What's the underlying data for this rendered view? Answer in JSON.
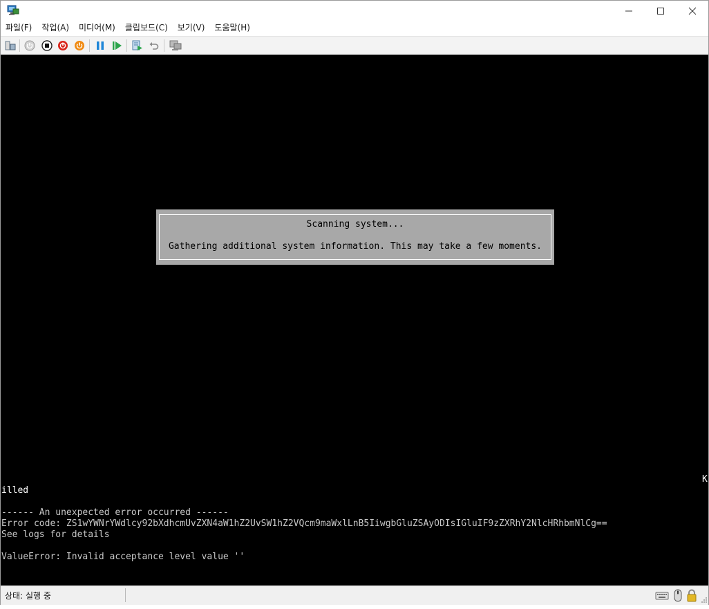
{
  "window": {
    "minimize_glyph": "—",
    "maximize_glyph": "☐",
    "close_glyph": "✕"
  },
  "menu": {
    "items": [
      "파일(F)",
      "작업(A)",
      "미디어(M)",
      "클립보드(C)",
      "보기(V)",
      "도움말(H)"
    ]
  },
  "toolbar": {
    "icons": [
      "ctrl-alt-del-icon",
      "start-icon",
      "turn-off-icon",
      "shut-down-icon",
      "power-icon",
      "pause-icon",
      "resume-icon",
      "checkpoint-icon",
      "revert-icon",
      "enhanced-session-icon"
    ]
  },
  "console": {
    "dialog": {
      "title": "Scanning system...",
      "message": "Gathering additional system information. This may take a few moments."
    },
    "lines": [
      "illed",
      "------ An unexpected error occurred ------",
      "Error code: ZS1wYWNrYWdlcy92bXdhcmUvZXN4aW1hZ2UvSW1hZ2VQcm9maWxlLnB5IiwgbGluZSAyODIsIGluIF9zZXRhY2NlcHRhbmNlCg==",
      "See logs for details",
      "ValueError: Invalid acceptance level value ''"
    ],
    "stray_char": "K"
  },
  "status": {
    "text": "상태: 실행 중"
  },
  "colors": {
    "console_bg": "#000000",
    "dialog_bg": "#a8a8a8",
    "console_text": "#c8c8c8"
  }
}
